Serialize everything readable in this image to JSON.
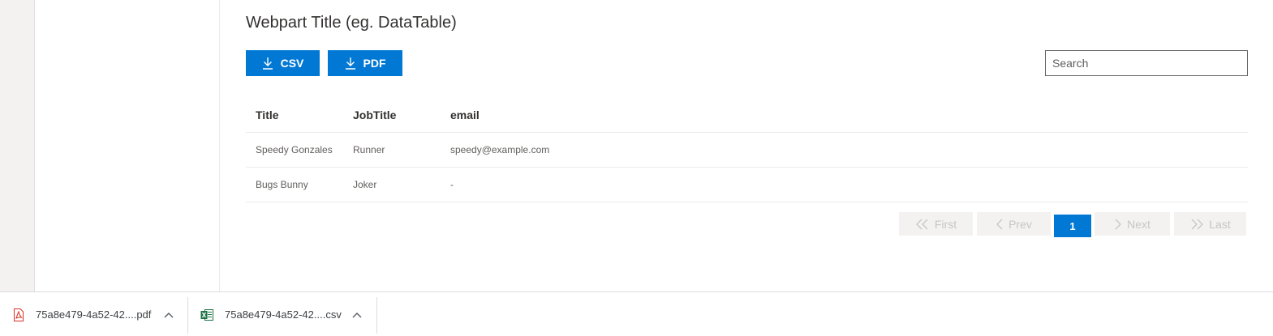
{
  "webpart": {
    "title": "Webpart Title (eg. DataTable)",
    "buttons": {
      "csv_label": "CSV",
      "pdf_label": "PDF"
    },
    "search": {
      "placeholder": "Search",
      "value": ""
    }
  },
  "table": {
    "columns": [
      "Title",
      "JobTitle",
      "email"
    ],
    "rows": [
      [
        "Speedy Gonzales",
        "Runner",
        "speedy@example.com"
      ],
      [
        "Bugs Bunny",
        "Joker",
        "-"
      ]
    ]
  },
  "pagination": {
    "first_label": "First",
    "prev_label": "Prev",
    "current_page": "1",
    "next_label": "Next",
    "last_label": "Last"
  },
  "downloads": [
    {
      "filename": "75a8e479-4a52-42....pdf",
      "icon": "pdf-file-icon"
    },
    {
      "filename": "75a8e479-4a52-42....csv",
      "icon": "excel-file-icon"
    }
  ],
  "colors": {
    "accent": "#0078d4",
    "pager_disabled_bg": "#f3f2f1",
    "pager_disabled_text": "#c8c6c4"
  }
}
